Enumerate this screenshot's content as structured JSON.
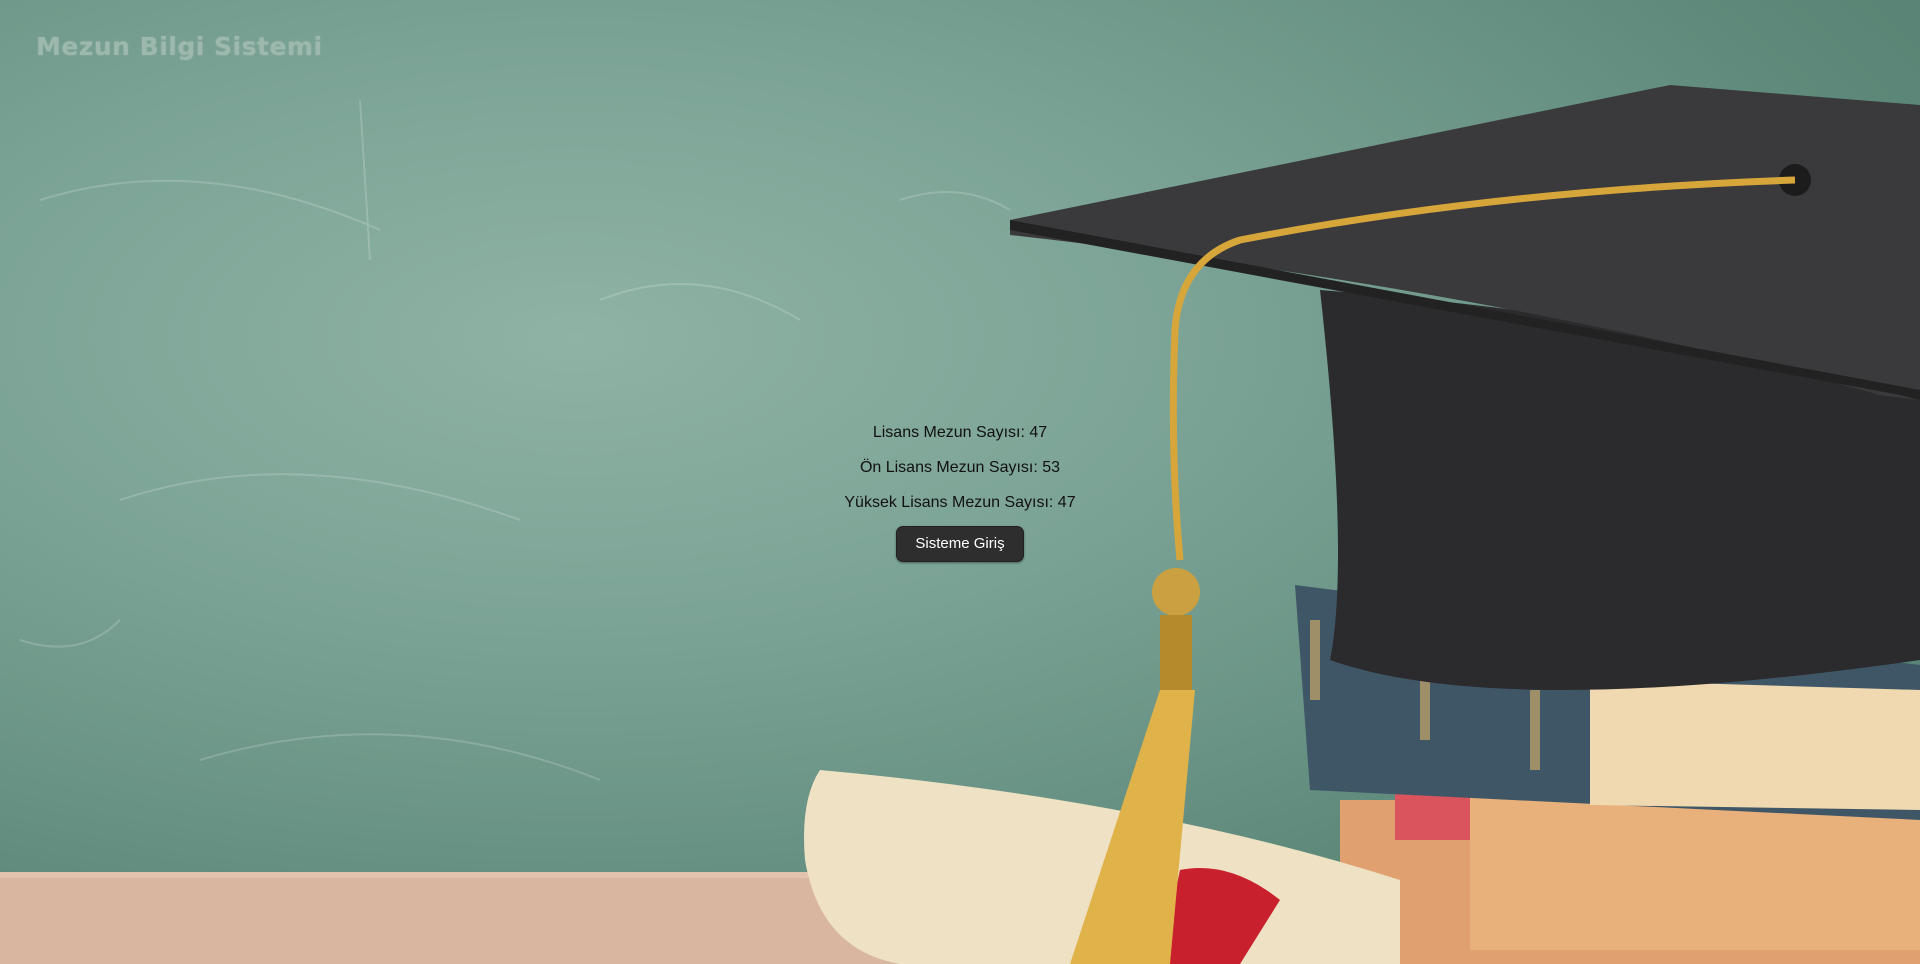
{
  "header": {
    "title": "Mezun Bilgi Sistemi"
  },
  "stats": {
    "lisans": "Lisans Mezun Sayısı: 47",
    "on_lisans": "Ön Lisans Mezun Sayısı: 53",
    "yuksek_lisans": "Yüksek Lisans Mezun Sayısı: 47"
  },
  "actions": {
    "login_label": "Sisteme Giriş"
  },
  "colors": {
    "chalkboard": "#7aa294",
    "button_bg": "#2e2e2e",
    "button_text": "#ffffff",
    "title_text": "#9db8ad"
  }
}
